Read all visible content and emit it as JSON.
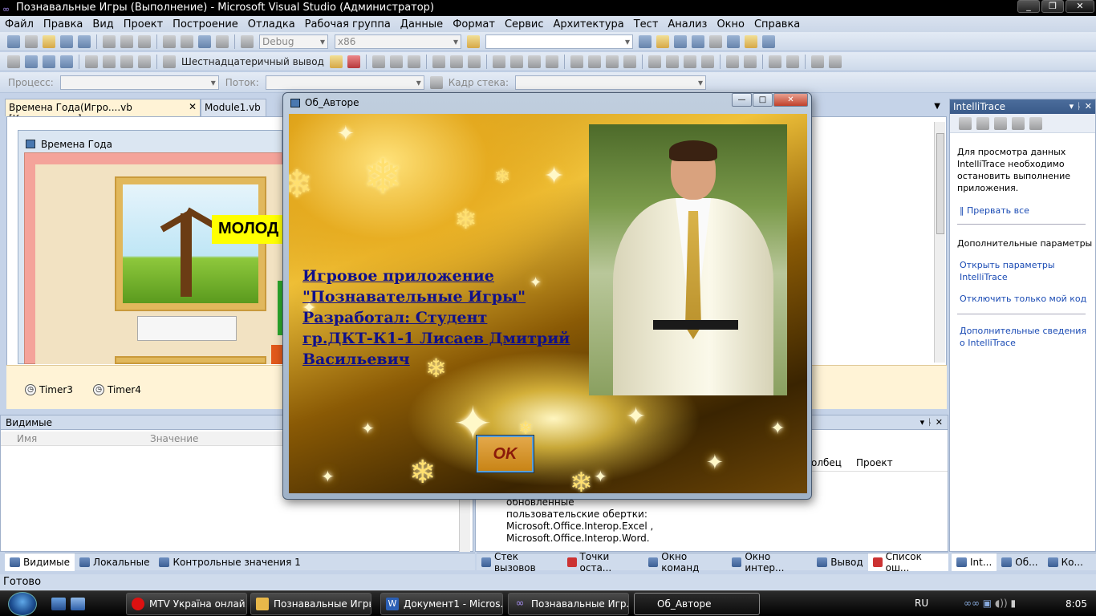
{
  "window": {
    "title": "Познавальные Игры (Выполнение) - Microsoft Visual Studio (Администратор)",
    "icon": "vs-infinity-icon"
  },
  "menu": [
    "Файл",
    "Правка",
    "Вид",
    "Проект",
    "Построение",
    "Отладка",
    "Рабочая группа",
    "Данные",
    "Формат",
    "Сервис",
    "Архитектура",
    "Тест",
    "Анализ",
    "Окно",
    "Справка"
  ],
  "toolbar1": {
    "config": "Debug",
    "platform": "x86",
    "search_value": ""
  },
  "toolbar2": {
    "hex_label": "Шестнадцатеричный вывод"
  },
  "toolbar3": {
    "process_label": "Процесс:",
    "thread_label": "Поток:",
    "stack_label": "Кадр стека:"
  },
  "doc_tabs": [
    {
      "label": "Времена Года(Игро....vb [Конструктор]",
      "active": true
    },
    {
      "label": "Module1.vb",
      "active": false
    }
  ],
  "designer": {
    "form_title": "Времена Года",
    "banner": "МОЛОД",
    "timers": [
      "Timer3",
      "Timer4"
    ]
  },
  "intellitrace": {
    "title": "IntelliTrace",
    "message": [
      "Для просмотра данных",
      "IntelliTrace необходимо",
      "остановить выполнение",
      "приложения."
    ],
    "break_all": "Прервать все",
    "section": "Дополнительные параметры",
    "links": [
      [
        "Открыть параметры",
        "IntelliTrace"
      ],
      [
        "Отключить только мой код"
      ]
    ],
    "more": [
      "Дополнительные сведения",
      "о IntelliTrace"
    ]
  },
  "watch": {
    "title": "Видимые",
    "col_name": "Имя",
    "col_value": "Значение"
  },
  "errors": {
    "col_column": "олбец",
    "col_project": "Проект",
    "lines": [
      "обновленные",
      "пользовательские обертки:",
      "Microsoft.Office.Interop.Excel ,",
      "Microsoft.Office.Interop.Word."
    ]
  },
  "bottom_tabs_left": [
    "Видимые",
    "Локальные",
    "Контрольные значения 1"
  ],
  "bottom_tabs_right": [
    "Стек вызовов",
    "Точки оста...",
    "Окно команд",
    "Окно интер...",
    "Вывод",
    "Список ош..."
  ],
  "bottom_tabs_side": [
    "Int...",
    "Об...",
    "Ко..."
  ],
  "status": "Готово",
  "dialog": {
    "title": "Об_Авторе",
    "text": [
      "Игровое приложение",
      "\"Познавательные Игры\"",
      "Разработал: Студент",
      "гр.ДКТ-К1-1 Лисаев Дмитрий",
      "Васильевич"
    ],
    "ok_label": "OK"
  },
  "taskbar": {
    "items": [
      {
        "label": "MTV Україна онлай...",
        "icon": "opera-icon",
        "color": "#d11"
      },
      {
        "label": "Познавальные Игры",
        "icon": "folder-icon",
        "color": "#e8b84a"
      },
      {
        "label": "Документ1 - Micros...",
        "icon": "word-icon",
        "color": "#2b5fb4"
      },
      {
        "label": "Познавальные Игр...",
        "icon": "vs-icon",
        "color": "#7a5fd0"
      },
      {
        "label": "Об_Авторе",
        "icon": "",
        "color": ""
      }
    ],
    "lang": "RU",
    "time": "8:05"
  }
}
